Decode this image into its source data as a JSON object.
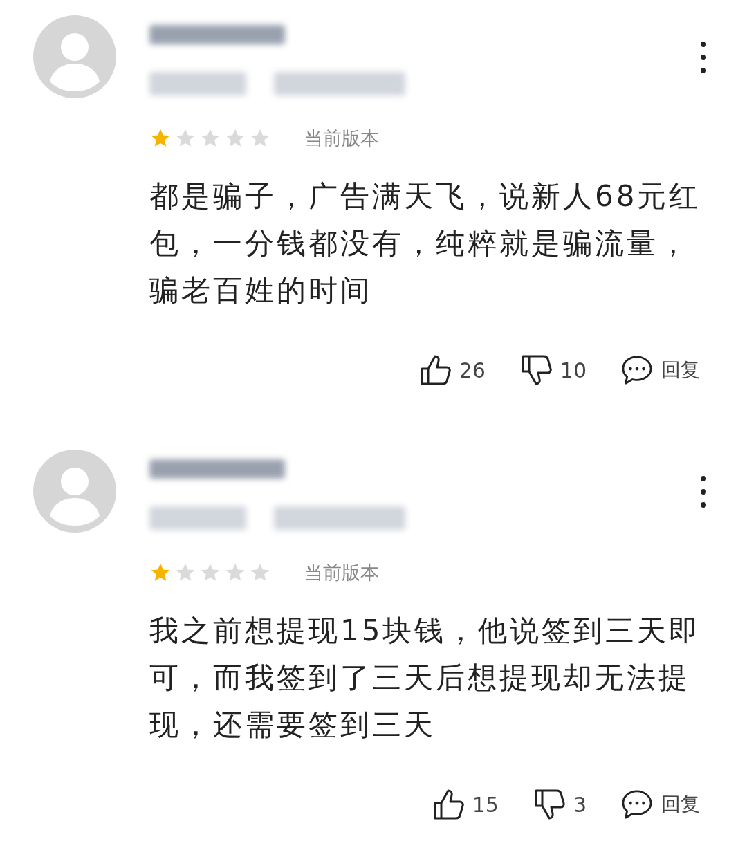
{
  "reviews": [
    {
      "stars": 1,
      "version_label": "当前版本",
      "text": "都是骗子，广告满天飞，说新人68元红包，一分钱都没有，纯粹就是骗流量，骗老百姓的时间",
      "likes": "26",
      "dislikes": "10",
      "reply_label": "回复"
    },
    {
      "stars": 1,
      "version_label": "当前版本",
      "text": "我之前想提现15块钱，他说签到三天即可，而我签到了三天后想提现却无法提现，还需要签到三天",
      "likes": "15",
      "dislikes": "3",
      "reply_label": "回复"
    }
  ]
}
